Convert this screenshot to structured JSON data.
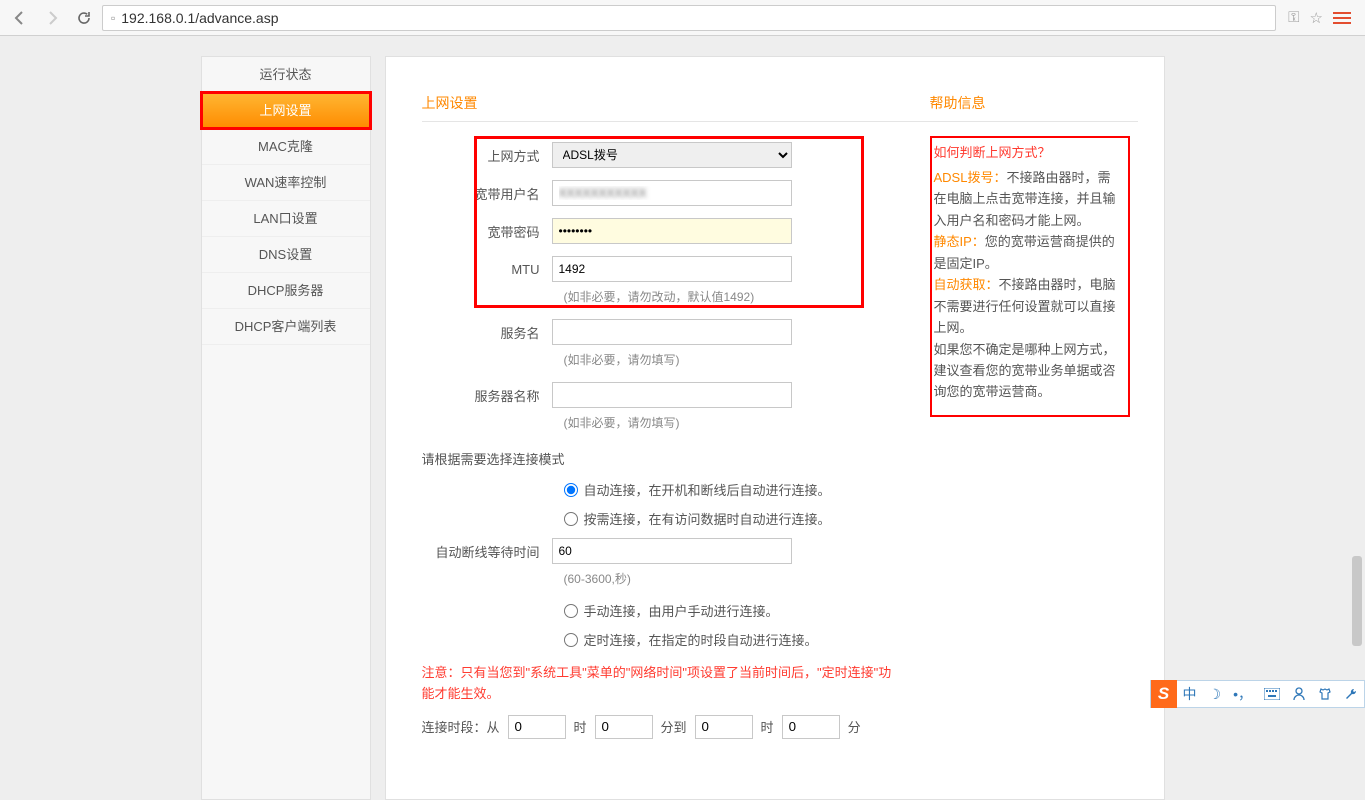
{
  "browser": {
    "url": "192.168.0.1/advance.asp"
  },
  "sidebar": {
    "items": [
      {
        "label": "运行状态",
        "active": false
      },
      {
        "label": "上网设置",
        "active": true
      },
      {
        "label": "MAC克隆",
        "active": false
      },
      {
        "label": "WAN速率控制",
        "active": false
      },
      {
        "label": "LAN口设置",
        "active": false
      },
      {
        "label": "DNS设置",
        "active": false
      },
      {
        "label": "DHCP服务器",
        "active": false
      },
      {
        "label": "DHCP客户端列表",
        "active": false
      }
    ]
  },
  "form": {
    "title": "上网设置",
    "wan_type_label": "上网方式",
    "wan_type_value": "ADSL拨号",
    "username_label": "宽带用户名",
    "username_value": "XXXXXXXXXXX",
    "password_label": "宽带密码",
    "password_value": "********",
    "mtu_label": "MTU",
    "mtu_value": "1492",
    "mtu_hint": "(如非必要，请勿改动，默认值1492)",
    "service_label": "服务名",
    "service_value": "",
    "service_hint": "(如非必要，请勿填写)",
    "server_label": "服务器名称",
    "server_value": "",
    "server_hint": "(如非必要，请勿填写)",
    "conn_mode_title": "请根据需要选择连接模式",
    "radio_auto": "自动连接，在开机和断线后自动进行连接。",
    "radio_demand": "按需连接，在有访问数据时自动进行连接。",
    "idle_label": "自动断线等待时间",
    "idle_value": "60",
    "idle_hint": "(60-3600,秒)",
    "radio_manual": "手动连接，由用户手动进行连接。",
    "radio_sched": "定时连接，在指定的时段自动进行连接。",
    "warning": "注意：只有当您到\"系统工具\"菜单的\"网络时间\"项设置了当前时间后，\"定时连接\"功能才能生效。",
    "time_label": "连接时段：从",
    "time_h1": "0",
    "time_m1": "0",
    "time_to": "分到",
    "time_h2": "0",
    "time_m2": "0",
    "time_hour": "时",
    "time_min": "分"
  },
  "help": {
    "title": "帮助信息",
    "q": "如何判断上网方式？",
    "adsl_label": "ADSL拨号：",
    "adsl_text": "不接路由器时，需在电脑上点击宽带连接，并且输入用户名和密码才能上网。",
    "static_label": "静态IP：",
    "static_text": "您的宽带运营商提供的是固定IP。",
    "auto_label": "自动获取：",
    "auto_text": "不接路由器时，电脑不需要进行任何设置就可以直接上网。",
    "footer": "如果您不确定是哪种上网方式，建议查看您的宽带业务单据或咨询您的宽带运营商。"
  },
  "ime": {
    "cn": "中",
    "punct": "•，",
    "kbd": "�键"
  }
}
